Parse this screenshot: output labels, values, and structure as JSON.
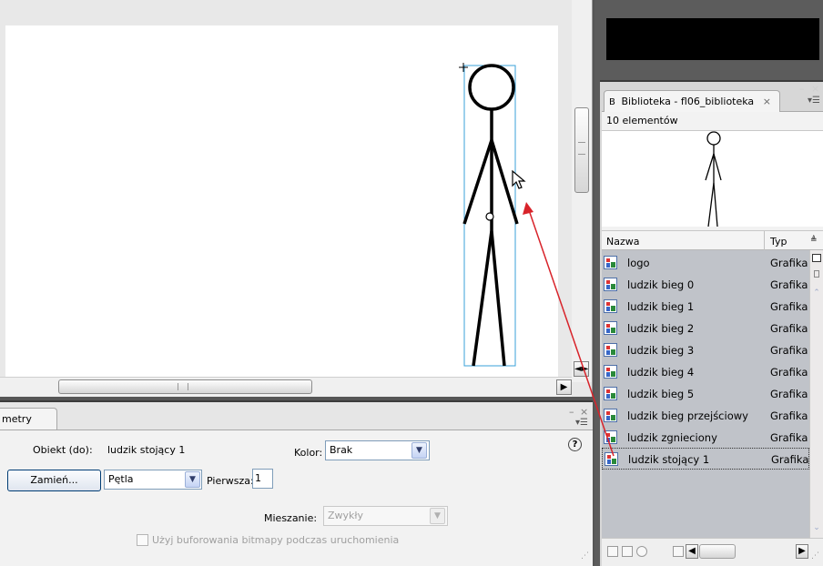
{
  "stage": {
    "scroll_right_label": "▶"
  },
  "properties": {
    "tab_label": "metry",
    "object_label": "Obiekt (do):",
    "object_value": "ludzik stojący 1",
    "color_label": "Kolor:",
    "color_value": "Brak",
    "swap_button_label": "Zamień...",
    "loop_value": "Pętla",
    "first_label": "Pierwsza:",
    "first_value": "1",
    "blend_label": "Mieszanie:",
    "blend_value": "Zwykły",
    "bitmap_cache_label": "Użyj buforowania bitmapy podczas uruchomienia",
    "help_icon": "?"
  },
  "library": {
    "tab_label": "Biblioteka - fl06_biblioteka",
    "count_label": "10 elementów",
    "col_name": "Nazwa",
    "col_type": "Typ",
    "items": [
      {
        "name": "logo",
        "type": "Grafika"
      },
      {
        "name": "ludzik bieg 0",
        "type": "Grafika"
      },
      {
        "name": "ludzik bieg 1",
        "type": "Grafika"
      },
      {
        "name": "ludzik bieg 2",
        "type": "Grafika"
      },
      {
        "name": "ludzik bieg 3",
        "type": "Grafika"
      },
      {
        "name": "ludzik bieg 4",
        "type": "Grafika"
      },
      {
        "name": "ludzik bieg 5",
        "type": "Grafika"
      },
      {
        "name": "ludzik bieg przejściowy",
        "type": "Grafika"
      },
      {
        "name": "ludzik zgnieciony",
        "type": "Grafika"
      },
      {
        "name": "ludzik stojący 1",
        "type": "Grafika",
        "selected": true
      }
    ]
  },
  "colors": {
    "selection_box": "#3aa0d8",
    "drag_arrow": "#d8232a",
    "library_list_bg": "#c0c3c9"
  }
}
